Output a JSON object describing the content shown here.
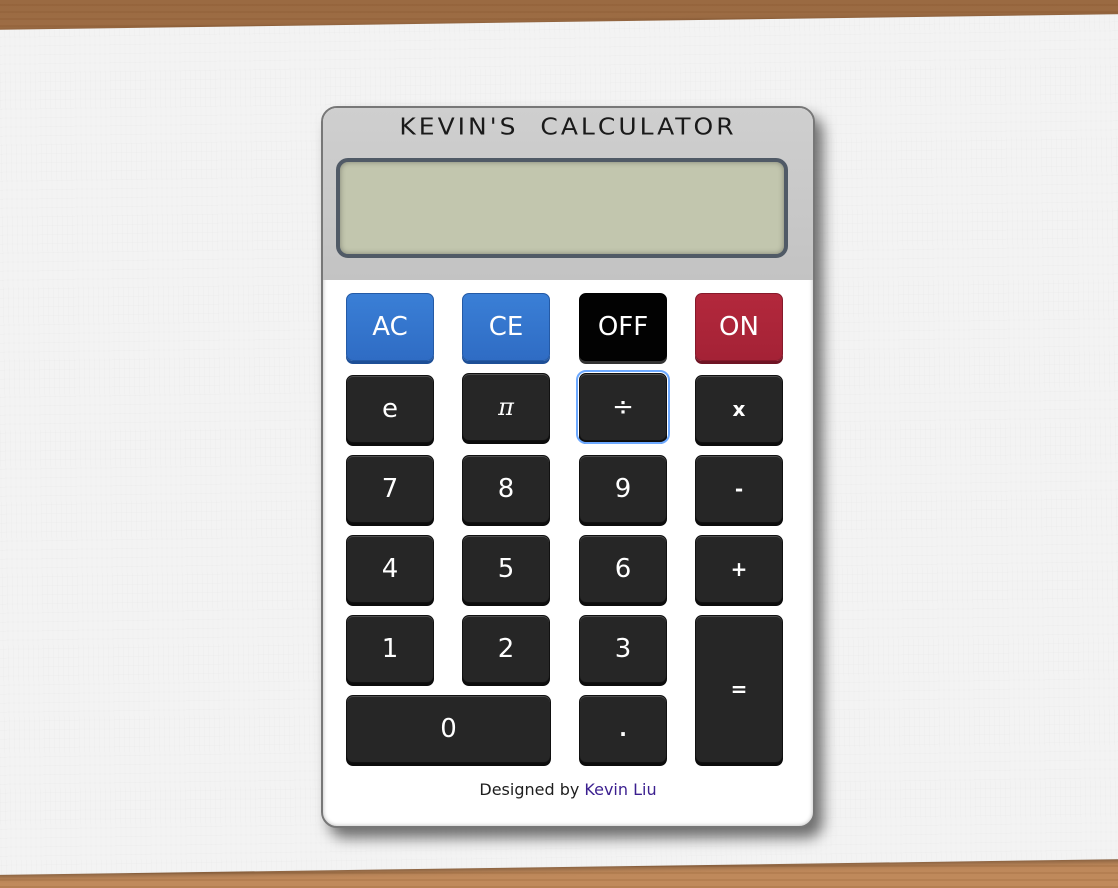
{
  "calculator": {
    "title": "KEVIN'S  CALCULATOR",
    "display_value": "",
    "keys": {
      "ac": "AC",
      "ce": "CE",
      "off": "OFF",
      "on": "ON",
      "e": "e",
      "pi": "π",
      "divide": "÷",
      "multiply": "x",
      "seven": "7",
      "eight": "8",
      "nine": "9",
      "minus": "-",
      "four": "4",
      "five": "5",
      "six": "6",
      "plus": "+",
      "one": "1",
      "two": "2",
      "three": "3",
      "equals": "=",
      "zero": "0",
      "decimal": "."
    },
    "footer": {
      "prefix": "Designed by",
      "author": "Kevin Liu"
    },
    "colors": {
      "ac_key": "#3377d0",
      "ce_key": "#3377d0",
      "off_key": "#000000",
      "on_key": "#aa2439",
      "number_key": "#262626",
      "display": "#c2c6ae",
      "author_link": "#3b1f8f"
    }
  }
}
